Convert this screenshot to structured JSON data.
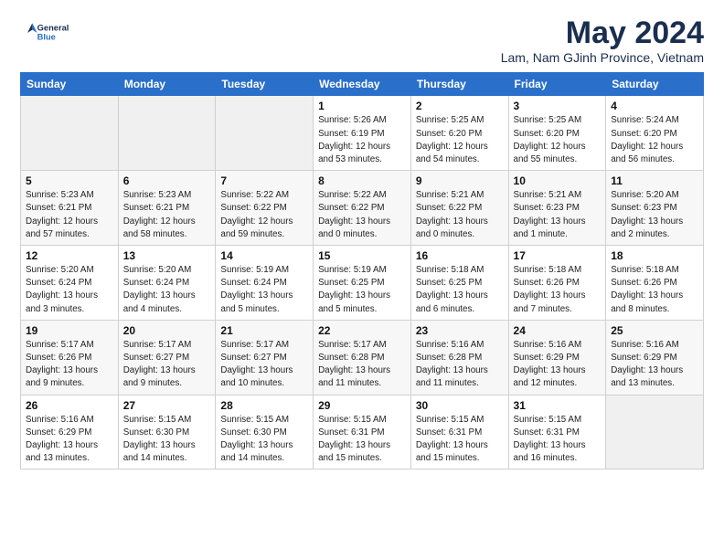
{
  "logo": {
    "line1": "General",
    "line2": "Blue"
  },
  "title": "May 2024",
  "subtitle": "Lam, Nam GJinh Province, Vietnam",
  "days_of_week": [
    "Sunday",
    "Monday",
    "Tuesday",
    "Wednesday",
    "Thursday",
    "Friday",
    "Saturday"
  ],
  "weeks": [
    [
      {
        "day": "",
        "info": ""
      },
      {
        "day": "",
        "info": ""
      },
      {
        "day": "",
        "info": ""
      },
      {
        "day": "1",
        "info": "Sunrise: 5:26 AM\nSunset: 6:19 PM\nDaylight: 12 hours\nand 53 minutes."
      },
      {
        "day": "2",
        "info": "Sunrise: 5:25 AM\nSunset: 6:20 PM\nDaylight: 12 hours\nand 54 minutes."
      },
      {
        "day": "3",
        "info": "Sunrise: 5:25 AM\nSunset: 6:20 PM\nDaylight: 12 hours\nand 55 minutes."
      },
      {
        "day": "4",
        "info": "Sunrise: 5:24 AM\nSunset: 6:20 PM\nDaylight: 12 hours\nand 56 minutes."
      }
    ],
    [
      {
        "day": "5",
        "info": "Sunrise: 5:23 AM\nSunset: 6:21 PM\nDaylight: 12 hours\nand 57 minutes."
      },
      {
        "day": "6",
        "info": "Sunrise: 5:23 AM\nSunset: 6:21 PM\nDaylight: 12 hours\nand 58 minutes."
      },
      {
        "day": "7",
        "info": "Sunrise: 5:22 AM\nSunset: 6:22 PM\nDaylight: 12 hours\nand 59 minutes."
      },
      {
        "day": "8",
        "info": "Sunrise: 5:22 AM\nSunset: 6:22 PM\nDaylight: 13 hours\nand 0 minutes."
      },
      {
        "day": "9",
        "info": "Sunrise: 5:21 AM\nSunset: 6:22 PM\nDaylight: 13 hours\nand 0 minutes."
      },
      {
        "day": "10",
        "info": "Sunrise: 5:21 AM\nSunset: 6:23 PM\nDaylight: 13 hours\nand 1 minute."
      },
      {
        "day": "11",
        "info": "Sunrise: 5:20 AM\nSunset: 6:23 PM\nDaylight: 13 hours\nand 2 minutes."
      }
    ],
    [
      {
        "day": "12",
        "info": "Sunrise: 5:20 AM\nSunset: 6:24 PM\nDaylight: 13 hours\nand 3 minutes."
      },
      {
        "day": "13",
        "info": "Sunrise: 5:20 AM\nSunset: 6:24 PM\nDaylight: 13 hours\nand 4 minutes."
      },
      {
        "day": "14",
        "info": "Sunrise: 5:19 AM\nSunset: 6:24 PM\nDaylight: 13 hours\nand 5 minutes."
      },
      {
        "day": "15",
        "info": "Sunrise: 5:19 AM\nSunset: 6:25 PM\nDaylight: 13 hours\nand 5 minutes."
      },
      {
        "day": "16",
        "info": "Sunrise: 5:18 AM\nSunset: 6:25 PM\nDaylight: 13 hours\nand 6 minutes."
      },
      {
        "day": "17",
        "info": "Sunrise: 5:18 AM\nSunset: 6:26 PM\nDaylight: 13 hours\nand 7 minutes."
      },
      {
        "day": "18",
        "info": "Sunrise: 5:18 AM\nSunset: 6:26 PM\nDaylight: 13 hours\nand 8 minutes."
      }
    ],
    [
      {
        "day": "19",
        "info": "Sunrise: 5:17 AM\nSunset: 6:26 PM\nDaylight: 13 hours\nand 9 minutes."
      },
      {
        "day": "20",
        "info": "Sunrise: 5:17 AM\nSunset: 6:27 PM\nDaylight: 13 hours\nand 9 minutes."
      },
      {
        "day": "21",
        "info": "Sunrise: 5:17 AM\nSunset: 6:27 PM\nDaylight: 13 hours\nand 10 minutes."
      },
      {
        "day": "22",
        "info": "Sunrise: 5:17 AM\nSunset: 6:28 PM\nDaylight: 13 hours\nand 11 minutes."
      },
      {
        "day": "23",
        "info": "Sunrise: 5:16 AM\nSunset: 6:28 PM\nDaylight: 13 hours\nand 11 minutes."
      },
      {
        "day": "24",
        "info": "Sunrise: 5:16 AM\nSunset: 6:29 PM\nDaylight: 13 hours\nand 12 minutes."
      },
      {
        "day": "25",
        "info": "Sunrise: 5:16 AM\nSunset: 6:29 PM\nDaylight: 13 hours\nand 13 minutes."
      }
    ],
    [
      {
        "day": "26",
        "info": "Sunrise: 5:16 AM\nSunset: 6:29 PM\nDaylight: 13 hours\nand 13 minutes."
      },
      {
        "day": "27",
        "info": "Sunrise: 5:15 AM\nSunset: 6:30 PM\nDaylight: 13 hours\nand 14 minutes."
      },
      {
        "day": "28",
        "info": "Sunrise: 5:15 AM\nSunset: 6:30 PM\nDaylight: 13 hours\nand 14 minutes."
      },
      {
        "day": "29",
        "info": "Sunrise: 5:15 AM\nSunset: 6:31 PM\nDaylight: 13 hours\nand 15 minutes."
      },
      {
        "day": "30",
        "info": "Sunrise: 5:15 AM\nSunset: 6:31 PM\nDaylight: 13 hours\nand 15 minutes."
      },
      {
        "day": "31",
        "info": "Sunrise: 5:15 AM\nSunset: 6:31 PM\nDaylight: 13 hours\nand 16 minutes."
      },
      {
        "day": "",
        "info": ""
      }
    ]
  ]
}
